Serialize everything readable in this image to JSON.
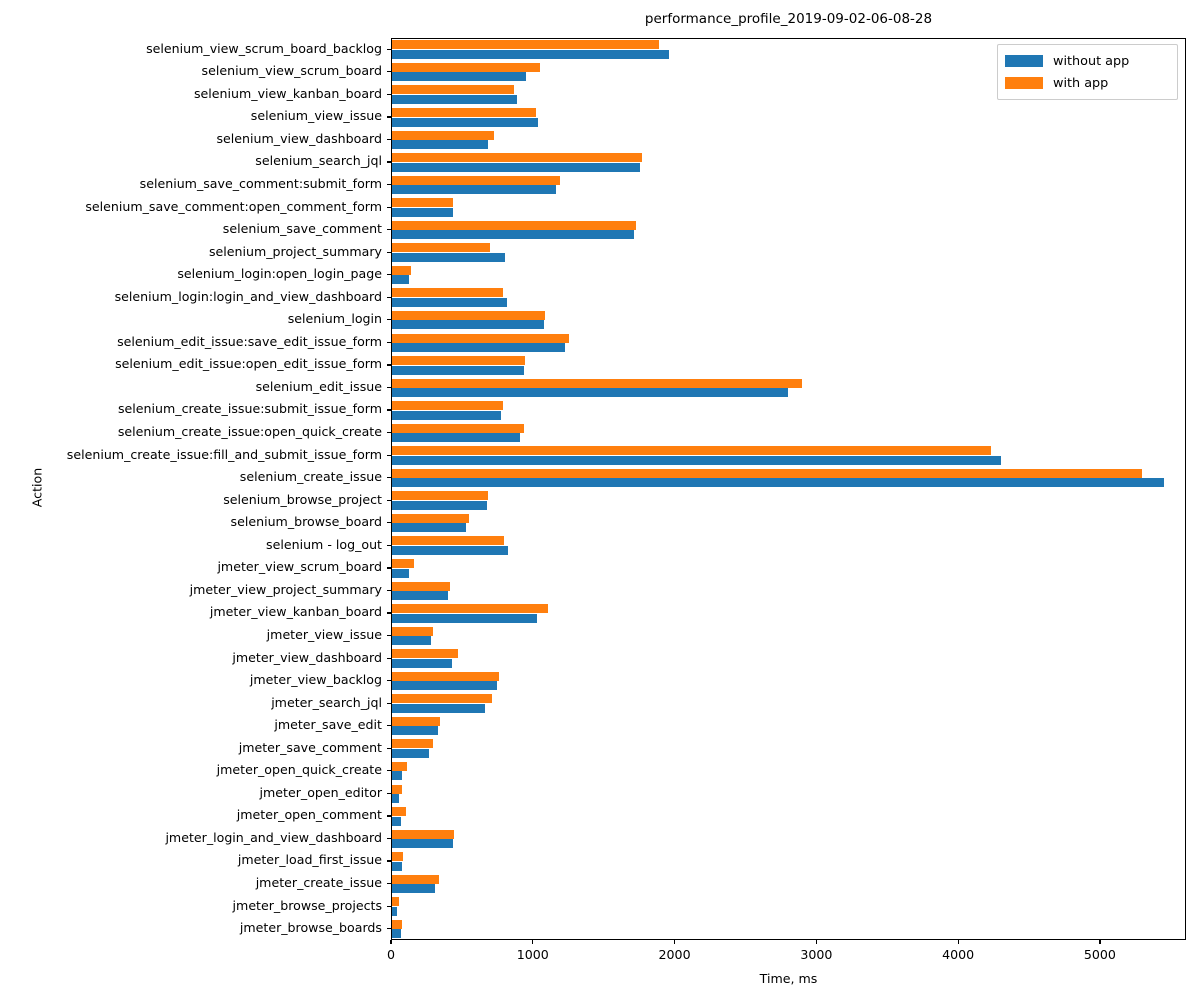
{
  "chart_data": {
    "type": "bar",
    "orientation": "horizontal",
    "title": "performance_profile_2019-09-02-06-08-28",
    "xlabel": "Time, ms",
    "ylabel": "Action",
    "xlim": [
      0,
      5607
    ],
    "xticks": [
      0,
      1000,
      2000,
      3000,
      4000,
      5000
    ],
    "xticklabels": [
      "0",
      "1000",
      "2000",
      "3000",
      "4000",
      "5000"
    ],
    "grid": false,
    "legend_position": "upper right",
    "colors": {
      "without app": "#1f77b4",
      "with app": "#ff7f0e"
    },
    "categories": [
      "selenium_view_scrum_board_backlog",
      "selenium_view_scrum_board",
      "selenium_view_kanban_board",
      "selenium_view_issue",
      "selenium_view_dashboard",
      "selenium_search_jql",
      "selenium_save_comment:submit_form",
      "selenium_save_comment:open_comment_form",
      "selenium_save_comment",
      "selenium_project_summary",
      "selenium_login:open_login_page",
      "selenium_login:login_and_view_dashboard",
      "selenium_login",
      "selenium_edit_issue:save_edit_issue_form",
      "selenium_edit_issue:open_edit_issue_form",
      "selenium_edit_issue",
      "selenium_create_issue:submit_issue_form",
      "selenium_create_issue:open_quick_create",
      "selenium_create_issue:fill_and_submit_issue_form",
      "selenium_create_issue",
      "selenium_browse_project",
      "selenium_browse_board",
      "selenium - log_out",
      "jmeter_view_scrum_board",
      "jmeter_view_project_summary",
      "jmeter_view_kanban_board",
      "jmeter_view_issue",
      "jmeter_view_dashboard",
      "jmeter_view_backlog",
      "jmeter_search_jql",
      "jmeter_save_edit",
      "jmeter_save_comment",
      "jmeter_open_quick_create",
      "jmeter_open_editor",
      "jmeter_open_comment",
      "jmeter_login_and_view_dashboard",
      "jmeter_load_first_issue",
      "jmeter_create_issue",
      "jmeter_browse_projects",
      "jmeter_browse_boards"
    ],
    "series": [
      {
        "name": "without app",
        "color": "#1f77b4",
        "values": [
          1953,
          945,
          882,
          1030,
          677,
          1752,
          1160,
          427,
          1706,
          798,
          120,
          812,
          1072,
          1217,
          933,
          2790,
          770,
          902,
          4296,
          5448,
          672,
          525,
          818,
          120,
          392,
          1020,
          273,
          420,
          742,
          657,
          322,
          264,
          74,
          50,
          62,
          430,
          68,
          300,
          32,
          62
        ]
      },
      {
        "name": "with app",
        "color": "#ff7f0e",
        "values": [
          1883,
          1044,
          861,
          1016,
          719,
          1766,
          1188,
          432,
          1723,
          690,
          131,
          785,
          1082,
          1251,
          936,
          2895,
          780,
          928,
          4223,
          5292,
          680,
          540,
          790,
          155,
          406,
          1100,
          288,
          467,
          752,
          705,
          337,
          290,
          104,
          68,
          96,
          438,
          80,
          335,
          48,
          74
        ]
      }
    ]
  }
}
